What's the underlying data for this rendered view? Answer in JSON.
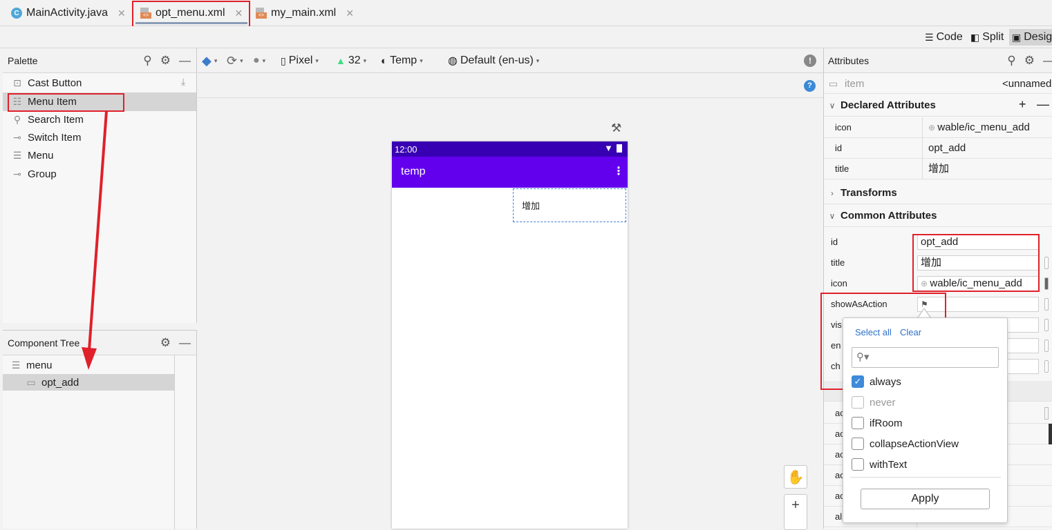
{
  "tabs": [
    {
      "label": "MainActivity.java",
      "icon": "java-class-icon"
    },
    {
      "label": "opt_menu.xml",
      "icon": "xml-layout-icon"
    },
    {
      "label": "my_main.xml",
      "icon": "xml-layout-icon"
    }
  ],
  "view_modes": {
    "code": "Code",
    "split": "Split",
    "design": "Desig"
  },
  "palette": {
    "title": "Palette",
    "items": [
      "Cast Button",
      "Menu Item",
      "Search Item",
      "Switch Item",
      "Menu",
      "Group"
    ]
  },
  "component_tree": {
    "title": "Component Tree",
    "root": "menu",
    "child": "opt_add"
  },
  "design_toolbar": {
    "device": "Pixel",
    "api": "32",
    "theme": "Temp",
    "locale": "Default (en-us)"
  },
  "phone": {
    "time": "12:00",
    "app_title": "temp",
    "menu_item_text": "增加"
  },
  "attributes": {
    "title": "Attributes",
    "item_type": "item",
    "item_name": "<unnamed",
    "declared_header": "Declared Attributes",
    "declared": [
      {
        "key": "icon",
        "value": "wable/ic_menu_add"
      },
      {
        "key": "id",
        "value": "opt_add"
      },
      {
        "key": "title",
        "value": "增加"
      }
    ],
    "transforms_header": "Transforms",
    "common_header": "Common Attributes",
    "common": [
      {
        "key": "id",
        "value": "opt_add"
      },
      {
        "key": "title",
        "value": "增加"
      },
      {
        "key": "icon",
        "value": "wable/ic_menu_add"
      },
      {
        "key": "showAsAction",
        "value": ""
      },
      {
        "key": "vis",
        "value": ""
      },
      {
        "key": "en",
        "value": ""
      },
      {
        "key": "ch",
        "value": ""
      }
    ],
    "lower_keys": [
      "ac",
      "ac",
      "ac",
      "ac",
      "ac",
      "al"
    ]
  },
  "popup": {
    "select_all": "Select all",
    "clear": "Clear",
    "search_placeholder": "",
    "options": [
      {
        "label": "always",
        "checked": true
      },
      {
        "label": "never",
        "checked": false
      },
      {
        "label": "ifRoom",
        "checked": false
      },
      {
        "label": "collapseActionView",
        "checked": false
      },
      {
        "label": "withText",
        "checked": false
      }
    ],
    "apply": "Apply"
  },
  "colors": {
    "highlight_red": "#e0202a",
    "status_bar": "#3700b3",
    "app_bar": "#6200ee",
    "checkbox_blue": "#3d8bd9"
  }
}
